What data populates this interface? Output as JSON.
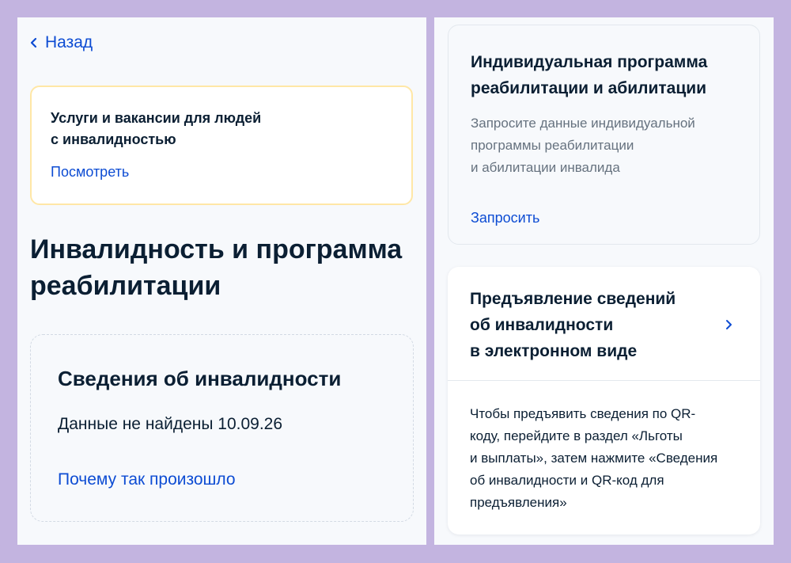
{
  "nav": {
    "back_label": "Назад"
  },
  "notice": {
    "title": "Услуги и вакансии для людей\nс инвалидностью",
    "link": "Посмотреть"
  },
  "page_title": "Инвалидность и программа реабилитации",
  "disability_card": {
    "title": "Сведения об инвалидности",
    "value": "Данные не найдены 10.09.26",
    "link": "Почему так произошло"
  },
  "ipra_card": {
    "title": "Индивидуальная программа реабилитации и абилитации",
    "description": "Запросите данные индивидуальной\nпрограммы реабилитации\nи абилитации инвалида",
    "link": "Запросить"
  },
  "electronic_card": {
    "title": "Предъявление сведений\nоб инвалидности\nв электронном виде",
    "text": "Чтобы предъявить сведения по QR-\nкоду, перейдите в раздел «Льготы\nи выплаты», затем нажмите «Сведения\nоб инвалидности и QR-код для\nпредъявления»"
  },
  "colors": {
    "frame": "#c3b4e0",
    "panel": "#f7f9fc",
    "link": "#0d4cd3",
    "text": "#0b1f33",
    "secondary_text": "#66727f",
    "notice_border": "#ffe7a6"
  },
  "icons": {
    "back": "chevron-left-icon",
    "forward": "chevron-right-icon"
  }
}
